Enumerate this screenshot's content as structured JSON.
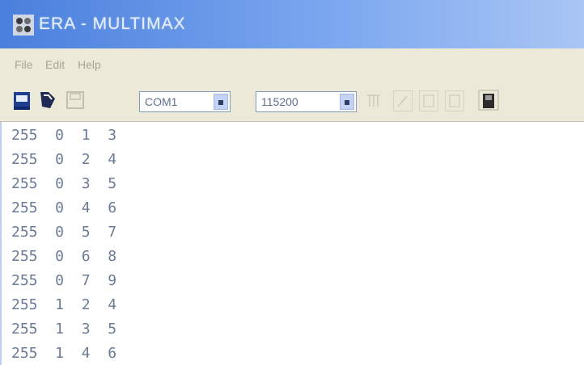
{
  "window": {
    "title": "ERA - MULTIMAX"
  },
  "menu": {
    "items": [
      "File",
      "Edit",
      "Help"
    ]
  },
  "toolbar": {
    "port": "COM1",
    "baud": "115200"
  },
  "console": {
    "lines": [
      "255  0  1  3",
      "255  0  2  4",
      "255  0  3  5",
      "255  0  4  6",
      "255  0  5  7",
      "255  0  6  8",
      "255  0  7  9",
      "255  1  2  4",
      "255  1  3  5",
      "255  1  4  6"
    ]
  },
  "colors": {
    "titlebar": "#4a7fdc",
    "chrome": "#ece9d8",
    "text": "#6b7b96"
  }
}
